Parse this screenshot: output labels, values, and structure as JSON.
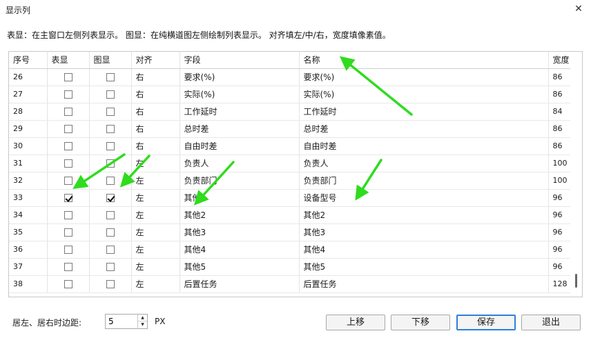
{
  "window": {
    "title": "显示列",
    "close_glyph": "✕"
  },
  "description": "表显：在主窗口左侧列表显示。 图显：在纯横道图左侧绘制列表显示。 对齐填左/中/右，宽度填像素值。",
  "columns": {
    "seq": "序号",
    "table_show": "表显",
    "chart_show": "图显",
    "align": "对齐",
    "field": "字段",
    "name": "名称",
    "width": "宽度"
  },
  "rows": [
    {
      "seq": "26",
      "table_show": false,
      "chart_show": false,
      "align": "右",
      "field": "要求(%)",
      "name": "要求(%)",
      "width": "86"
    },
    {
      "seq": "27",
      "table_show": false,
      "chart_show": false,
      "align": "右",
      "field": "实际(%)",
      "name": "实际(%)",
      "width": "86"
    },
    {
      "seq": "28",
      "table_show": false,
      "chart_show": false,
      "align": "右",
      "field": "工作延时",
      "name": "工作延时",
      "width": "84"
    },
    {
      "seq": "29",
      "table_show": false,
      "chart_show": false,
      "align": "右",
      "field": "总时差",
      "name": "总时差",
      "width": "86"
    },
    {
      "seq": "30",
      "table_show": false,
      "chart_show": false,
      "align": "右",
      "field": "自由时差",
      "name": "自由时差",
      "width": "86"
    },
    {
      "seq": "31",
      "table_show": false,
      "chart_show": false,
      "align": "左",
      "field": "负责人",
      "name": "负责人",
      "width": "100"
    },
    {
      "seq": "32",
      "table_show": false,
      "chart_show": false,
      "align": "左",
      "field": "负责部门",
      "name": "负责部门",
      "width": "100"
    },
    {
      "seq": "33",
      "table_show": true,
      "chart_show": true,
      "align": "左",
      "field": "其他1",
      "name": "设备型号",
      "width": "96"
    },
    {
      "seq": "34",
      "table_show": false,
      "chart_show": false,
      "align": "左",
      "field": "其他2",
      "name": "其他2",
      "width": "96"
    },
    {
      "seq": "35",
      "table_show": false,
      "chart_show": false,
      "align": "左",
      "field": "其他3",
      "name": "其他3",
      "width": "96"
    },
    {
      "seq": "36",
      "table_show": false,
      "chart_show": false,
      "align": "左",
      "field": "其他4",
      "name": "其他4",
      "width": "96"
    },
    {
      "seq": "37",
      "table_show": false,
      "chart_show": false,
      "align": "左",
      "field": "其他5",
      "name": "其他5",
      "width": "96"
    },
    {
      "seq": "38",
      "table_show": false,
      "chart_show": false,
      "align": "左",
      "field": "后置任务",
      "name": "后置任务",
      "width": "128"
    }
  ],
  "footer": {
    "margin_label": "居左、居右时边距:",
    "margin_value": "5",
    "unit": "PX",
    "up_arrow": "▲",
    "down_arrow": "▼",
    "buttons": {
      "move_up": "上移",
      "move_down": "下移",
      "save": "保存",
      "exit": "退出"
    }
  },
  "annotation_color": "#2fdc1e"
}
